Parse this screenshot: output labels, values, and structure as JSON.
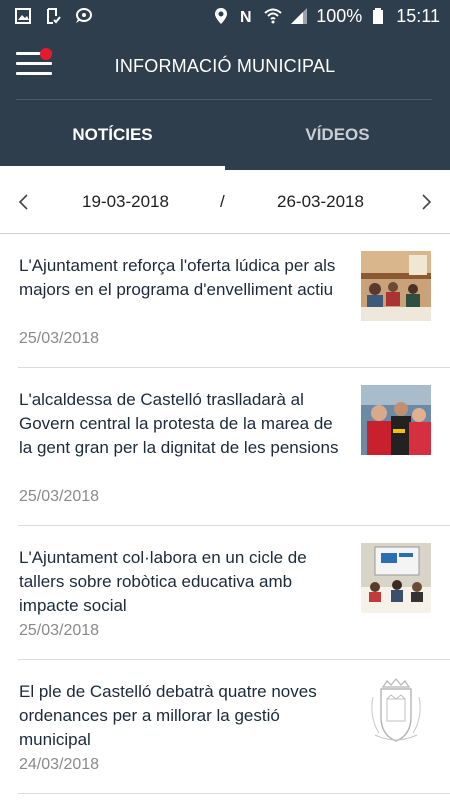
{
  "status_bar": {
    "left_icons": [
      "image-icon",
      "download-check-icon",
      "chat-icon"
    ],
    "right_icons": [
      "location-icon",
      "nfc-icon",
      "wifi-icon",
      "signal-icon",
      "battery-icon"
    ],
    "battery": "100%",
    "time": "15:11"
  },
  "header": {
    "title": "INFORMACIÓ MUNICIPAL",
    "notification_color": "#e8192c"
  },
  "tabs": [
    {
      "label": "NOTÍCIES",
      "active": true
    },
    {
      "label": "VÍDEOS",
      "active": false
    }
  ],
  "date_range": {
    "from": "19-03-2018",
    "separator": "/",
    "to": "26-03-2018"
  },
  "news": [
    {
      "title": "L'Ajuntament reforça l'oferta lúdica per als majors en el programa d'envelliment actiu",
      "date": "25/03/2018",
      "thumbnail": "photo-seniors-activity"
    },
    {
      "title": "L'alcaldessa de Castelló traslladarà al Govern central la protesta de la marea de la gent gran per la dignitat de les pensions",
      "date": "25/03/2018",
      "thumbnail": "photo-protest"
    },
    {
      "title": "L'Ajuntament col·labora en un cicle de tallers sobre robòtica educativa amb impacte social",
      "date": "25/03/2018",
      "thumbnail": "photo-robotics-workshop"
    },
    {
      "title": "El ple de Castelló debatrà quatre noves ordenances per a millorar la gestió municipal",
      "date": "24/03/2018",
      "thumbnail": "city-crest"
    }
  ],
  "colors": {
    "header_bg": "#2f3e4c",
    "title_text": "#1c2a3a",
    "date_text": "#8a8a8a"
  }
}
